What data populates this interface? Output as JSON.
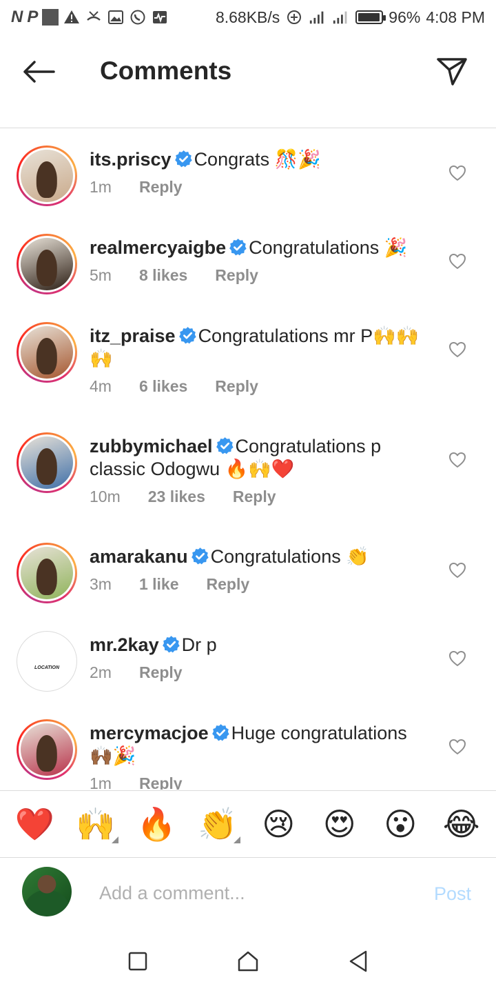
{
  "status_bar": {
    "left_glyphs": [
      "N",
      "P"
    ],
    "speed": "8.68KB/s",
    "battery_percent": "96%",
    "battery_level": 0.96,
    "time": "4:08 PM"
  },
  "header": {
    "title": "Comments",
    "back_icon": "arrow-left-icon",
    "share_icon": "paper-plane-icon"
  },
  "comments": [
    {
      "username": "its.priscy",
      "text": "Congrats 🎊🎉",
      "time": "1m",
      "likes": "",
      "reply": "Reply",
      "avatar_ring": true,
      "avatar_color": "#c9a98a"
    },
    {
      "username": "realmercyaigbe",
      "text": "Congratulations 🎉",
      "time": "5m",
      "likes": "8 likes",
      "reply": "Reply",
      "avatar_ring": true,
      "avatar_color": "#2c1e14"
    },
    {
      "username": "itz_praise",
      "text": "Congratulations mr P🙌🙌🙌",
      "time": "4m",
      "likes": "6 likes",
      "reply": "Reply",
      "avatar_ring": true,
      "avatar_color": "#a5562e"
    },
    {
      "username": "zubbymichael",
      "text": "Congratulations p classic Odogwu 🔥🙌❤️",
      "time": "10m",
      "likes": "23 likes",
      "reply": "Reply",
      "avatar_ring": true,
      "avatar_color": "#3f6fa8"
    },
    {
      "username": "amarakanu",
      "text": "Congratulations 👏",
      "time": "3m",
      "likes": "1 like",
      "reply": "Reply",
      "avatar_ring": true,
      "avatar_color": "#8fb35a"
    },
    {
      "username": "mr.2kay",
      "text": "Dr p",
      "time": "2m",
      "likes": "",
      "reply": "Reply",
      "avatar_ring": false,
      "avatar_color": "#ffffff",
      "avatar_text": "LOCATION"
    },
    {
      "username": "mercymacjoe",
      "text": "Huge congratulations 🙌🏾🎉",
      "time": "1m",
      "likes": "",
      "reply": "Reply",
      "avatar_ring": true,
      "avatar_color": "#b8324a"
    }
  ],
  "emoji_bar": [
    {
      "emoji": "❤️",
      "name": "red-heart",
      "has_more": false
    },
    {
      "emoji": "🙌",
      "name": "raising-hands",
      "has_more": true
    },
    {
      "emoji": "🔥",
      "name": "fire",
      "has_more": false
    },
    {
      "emoji": "👏",
      "name": "clapping-hands",
      "has_more": true
    },
    {
      "emoji": "😢",
      "name": "crying-face",
      "has_more": false
    },
    {
      "emoji": "😍",
      "name": "heart-eyes",
      "has_more": false
    },
    {
      "emoji": "😮",
      "name": "surprised-face",
      "has_more": false
    },
    {
      "emoji": "😂",
      "name": "tears-of-joy",
      "has_more": false
    }
  ],
  "composer": {
    "placeholder": "Add a comment...",
    "post_label": "Post"
  },
  "colors": {
    "verified": "#3897f0",
    "meta_text": "#8e8e8e",
    "post_disabled": "#b3dbff"
  }
}
